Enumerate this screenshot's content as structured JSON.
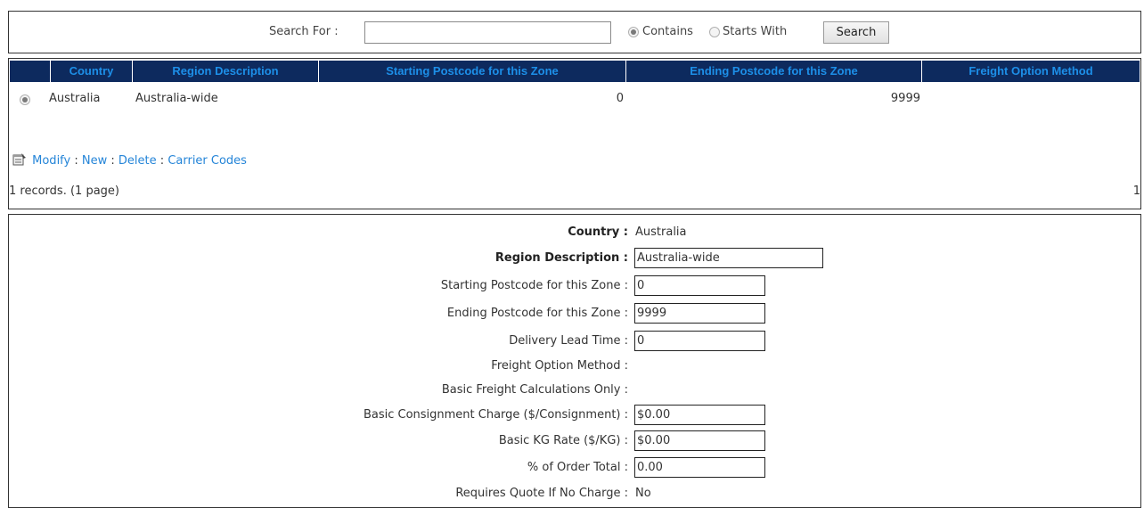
{
  "search": {
    "label": "Search For :",
    "value": "",
    "placeholder": "",
    "option_contains": "Contains",
    "option_starts_with": "Starts With",
    "selected_option": "Contains",
    "button_label": "Search"
  },
  "grid": {
    "columns": [
      "Country",
      "Region Description",
      "Starting Postcode for this Zone",
      "Ending Postcode for this Zone",
      "Freight Option Method"
    ],
    "rows": [
      {
        "country": "Australia",
        "region": "Australia-wide",
        "start": "0",
        "end": "9999",
        "freight": ""
      }
    ],
    "header_bg": "#0d2a5e",
    "header_text_color": "#1d8fe8"
  },
  "actions": {
    "modify": "Modify",
    "new": "New",
    "delete": "Delete",
    "carrier_codes": "Carrier Codes",
    "separator": ":"
  },
  "pager": {
    "records_text": "1 records. (1 page)",
    "page_number": "1"
  },
  "detail": {
    "country_label": "Country :",
    "country_value": "Australia",
    "region_label": "Region Description :",
    "region_value": "Australia-wide",
    "start_label": "Starting Postcode for this Zone :",
    "start_value": "0",
    "end_label": "Ending Postcode for this Zone :",
    "end_value": "9999",
    "lead_label": "Delivery Lead Time :",
    "lead_value": "0",
    "freight_label": "Freight Option Method :",
    "basic_calc_label": "Basic Freight Calculations Only :",
    "consignment_label": "Basic Consignment Charge ($/Consignment) :",
    "consignment_value": "$0.00",
    "kg_label": "Basic KG Rate ($/KG) :",
    "kg_value": "$0.00",
    "order_total_label": "% of Order Total :",
    "order_total_value": "0.00",
    "quote_label": "Requires Quote If No Charge :",
    "quote_value": "No"
  }
}
